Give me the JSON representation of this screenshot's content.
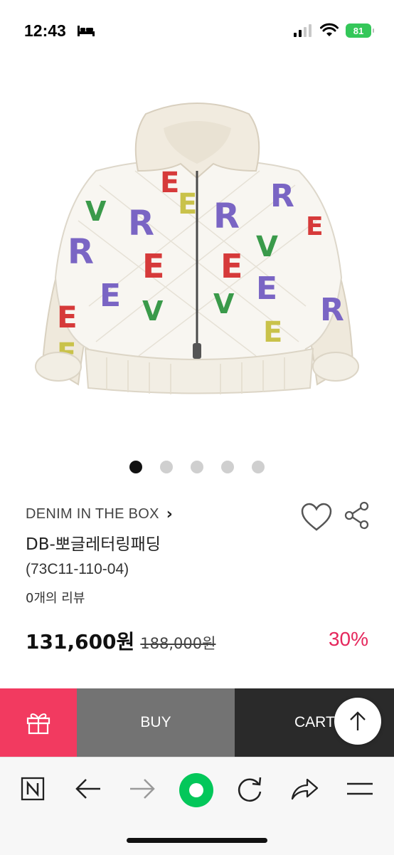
{
  "status_bar": {
    "time": "12:43",
    "battery": "81"
  },
  "gallery": {
    "dot_count": 5,
    "active_index": 0
  },
  "product": {
    "brand": "DENIM IN THE BOX",
    "brand_chevron": "›",
    "name": "DB-뽀글레터링패딩",
    "code": "(73C11-110-04)",
    "reviews": "0개의 리뷰",
    "price": "131,600원",
    "original_price": "188,000원",
    "discount": "30%"
  },
  "actions": {
    "buy_label": "BUY",
    "cart_label": "CART"
  },
  "icons": {
    "status": [
      "bed-icon",
      "signal-icon",
      "wifi-icon"
    ],
    "product": [
      "heart-icon",
      "share-icon"
    ],
    "toolbar": [
      "naver-icon",
      "back-arrow-icon",
      "forward-arrow-icon",
      "green-dot-icon",
      "refresh-icon",
      "share-arrow-icon",
      "menu-icon"
    ]
  },
  "colors": {
    "gift": "#f23a60",
    "buy": "#737373",
    "cart": "#2a2a2a",
    "discount": "#e5275c",
    "battery": "#34c759",
    "naver_green": "#03c75a"
  }
}
